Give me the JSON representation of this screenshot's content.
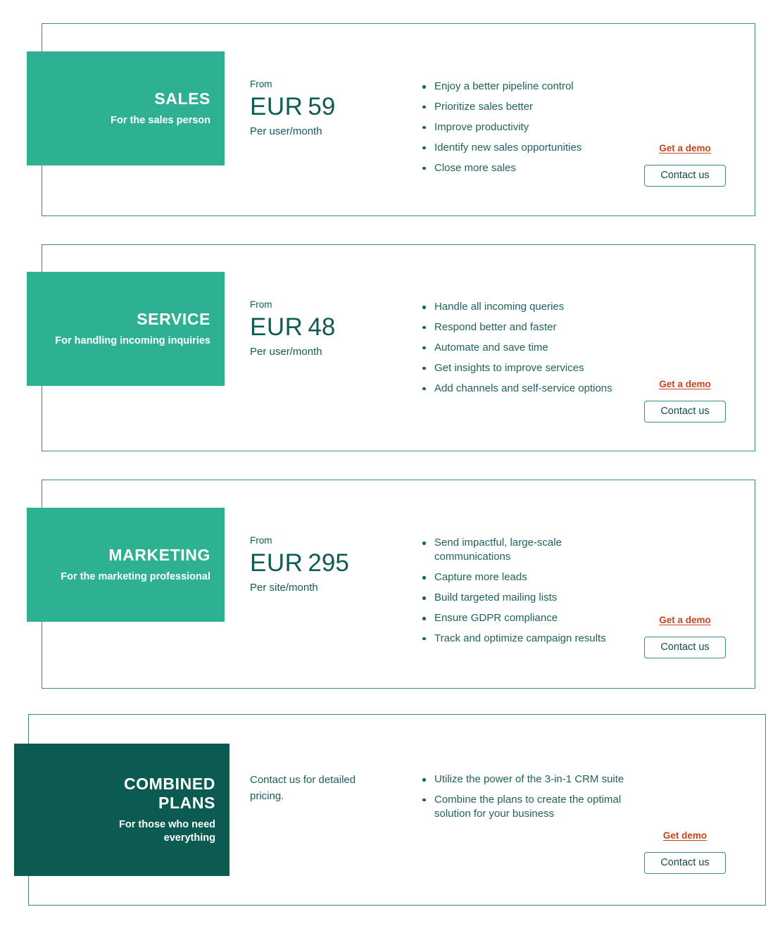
{
  "page": {
    "background_color": "#ffffff",
    "accent_color": "#2eb193",
    "dark_accent_color": "#0b5b52",
    "border_color": "#3f8a81",
    "text_color": "#20625d",
    "link_color": "#c8441a"
  },
  "plans": [
    {
      "name": "SALES",
      "tagline": "For the sales person",
      "price_prefix": "From",
      "currency": "EUR",
      "amount": "59",
      "period": "Per user/month",
      "features": [
        "Enjoy a better pipeline control",
        "Prioritize sales better",
        "Improve productivity",
        "Identify new sales opportunities",
        "Close more sales"
      ],
      "demo_label": "Get a demo",
      "contact_label": "Contact us"
    },
    {
      "name": "SERVICE",
      "tagline": "For handling incoming inquiries",
      "price_prefix": "From",
      "currency": "EUR",
      "amount": "48",
      "period": "Per user/month",
      "features": [
        "Handle all incoming queries",
        "Respond better and faster",
        "Automate and save time",
        "Get insights to improve services",
        "Add channels and self-service options"
      ],
      "demo_label": "Get a demo",
      "contact_label": "Contact us"
    },
    {
      "name": "MARKETING",
      "tagline": "For the marketing professional",
      "price_prefix": "From",
      "currency": "EUR",
      "amount": "295",
      "period": "Per site/month",
      "features": [
        "Send impactful, large-scale communications",
        "Capture more leads",
        "Build targeted mailing lists",
        "Ensure GDPR compliance",
        "Track and optimize campaign results"
      ],
      "demo_label": "Get a demo",
      "contact_label": "Contact us"
    },
    {
      "name": "COMBINED PLANS",
      "tagline": "For those who need everything",
      "price_note": "Contact us for detailed pricing.",
      "features": [
        "Utilize the power of the 3-in-1 CRM suite",
        "Combine the plans to create the optimal solution for your business"
      ],
      "demo_label": "Get demo",
      "contact_label": "Contact us"
    }
  ]
}
